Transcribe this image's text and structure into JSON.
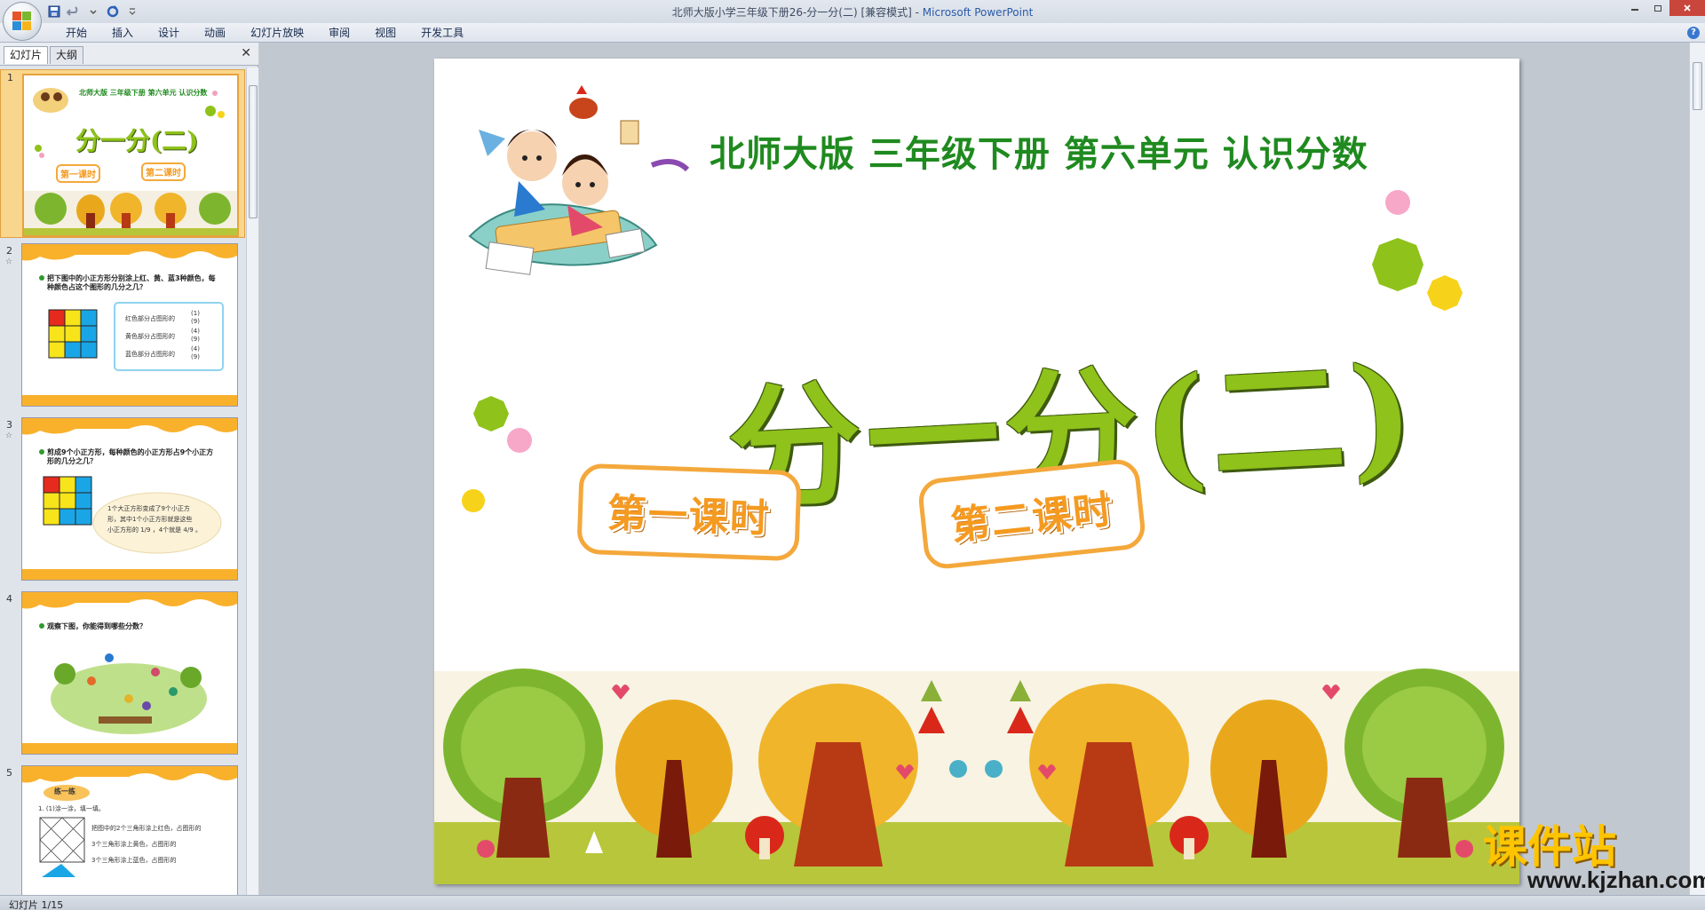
{
  "window": {
    "title": "北师大版小学三年级下册26-分一分(二) [兼容模式] - ",
    "app_name": "Microsoft PowerPoint"
  },
  "ribbon": {
    "tabs": [
      "开始",
      "插入",
      "设计",
      "动画",
      "幻灯片放映",
      "审阅",
      "视图",
      "开发工具"
    ]
  },
  "left_pane": {
    "tabs": [
      "幻灯片",
      "大纲"
    ],
    "close_glyph": "✕"
  },
  "thumbnails": [
    {
      "number": "1",
      "header": "北师大版  三年级下册  第六单元  认识分数",
      "title": "分一分(二)",
      "chips": [
        "第一课时",
        "第二课时"
      ]
    },
    {
      "number": "2",
      "question": "把下图中的小正方形分别涂上红、黄、蓝3种颜色，每种颜色占这个图形的几分之几？",
      "answers": [
        "红色部分占图形的",
        "黄色部分占图形的",
        "蓝色部分占图形的"
      ],
      "fractions": [
        [
          "1",
          "9"
        ],
        [
          "4",
          "9"
        ],
        [
          "4",
          "9"
        ]
      ]
    },
    {
      "number": "3",
      "question": "剪成9个小正方形，每种颜色的小正方形占9个小正方形的几分之几？",
      "bubble_lines": [
        "1个大正方形变成了9个小正方",
        "形，其中1个小正方形就是这些",
        "小正方形的 1/9 ，4个就是 4/9 。"
      ]
    },
    {
      "number": "4",
      "question": "观察下图，你能得到哪些分数？"
    },
    {
      "number": "5",
      "badge": "练一练",
      "lines": [
        "1.     (1)涂一涂，填一填。",
        "把图中的2个三角形涂上红色，占图形的",
        "3个三角形涂上黄色，占图形的",
        "3个三角形涂上蓝色，占图形的"
      ]
    }
  ],
  "slide": {
    "header": "北师大版  三年级下册  第六单元  认识分数",
    "title": "分一分(二)",
    "buttons": [
      "第一课时",
      "第二课时"
    ]
  },
  "status": {
    "text": "幻灯片 1/15"
  },
  "watermark": {
    "cn": "课件站",
    "url": "www.kjzhan.com"
  },
  "colors": {
    "header_green": "#1f8a1f",
    "title_green": "#8fc21a",
    "button_orange": "#f4a83b",
    "thumb_selected": "#f9d68d"
  }
}
